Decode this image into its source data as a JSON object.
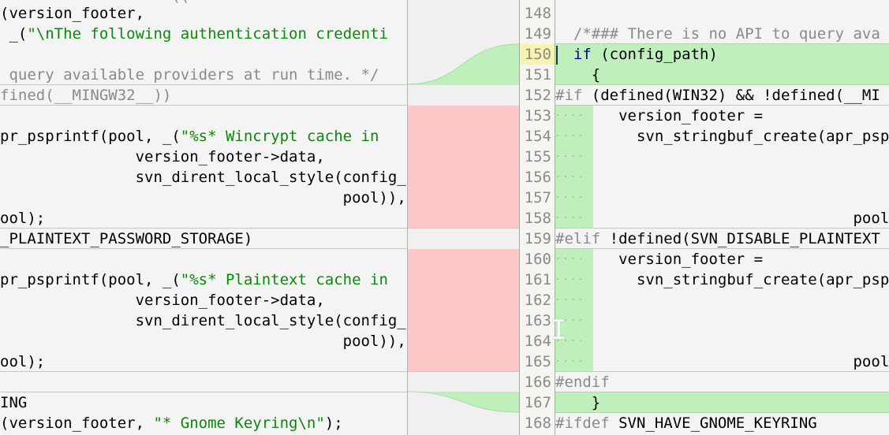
{
  "left_pane": {
    "lines": [
      {
        "text": "                   ((",
        "kind": "partial-top"
      },
      {
        "text": "(version_footer,",
        "kind": "code"
      },
      {
        "pre": " _(",
        "str": "\"\\nThe following authentication credenti",
        "kind": "code-string"
      },
      {
        "text": "",
        "kind": "blank"
      },
      {
        "text": " query available providers at run time. */",
        "kind": "comment"
      },
      {
        "text": "fined(__MINGW32__))",
        "kind": "preproc"
      },
      {
        "text": "",
        "kind": "blank"
      },
      {
        "pre": "pr_psprintf(pool, _(",
        "str": "\"%s* Wincrypt cache in ",
        "kind": "code-string"
      },
      {
        "text": "               version_footer->data,",
        "kind": "code"
      },
      {
        "text": "               svn_dirent_local_style(config_p",
        "kind": "code"
      },
      {
        "text": "                                      pool)),",
        "kind": "code"
      },
      {
        "text": "ool);",
        "kind": "code"
      },
      {
        "text": "_PLAINTEXT_PASSWORD_STORAGE)",
        "kind": "code"
      },
      {
        "text": "",
        "kind": "blank"
      },
      {
        "pre": "pr_psprintf(pool, _(",
        "str": "\"%s* Plaintext cache in",
        "kind": "code-string"
      },
      {
        "text": "               version_footer->data,",
        "kind": "code"
      },
      {
        "text": "               svn_dirent_local_style(config_p",
        "kind": "code"
      },
      {
        "text": "                                      pool)),",
        "kind": "code"
      },
      {
        "text": "ool);",
        "kind": "code"
      },
      {
        "text": "",
        "kind": "blank"
      },
      {
        "text": "ING",
        "kind": "code"
      },
      {
        "pre": "(version_footer, ",
        "str": "\"* Gnome Keyring\\n\"",
        "post": ");",
        "kind": "code-string"
      }
    ]
  },
  "right_pane": {
    "line_numbers": [
      "148",
      "149",
      "150",
      "151",
      "152",
      "153",
      "154",
      "155",
      "156",
      "157",
      "158",
      "159",
      "160",
      "161",
      "162",
      "163",
      "164",
      "165",
      "166",
      "167",
      "168"
    ],
    "current_line": "150",
    "lines": [
      {
        "text": ""
      },
      {
        "text": "  /*### There is no API to query ava",
        "kind": "comment"
      },
      {
        "kw": "if",
        "text": " (config_path)",
        "lead": "  ",
        "kind": "added"
      },
      {
        "text": "    {",
        "kind": "added"
      },
      {
        "pp": "#if",
        "text": " (defined(WIN32) && !defined(__MI",
        "kind": "preproc"
      },
      {
        "text": "   version_footer =",
        "kind": "indent-added"
      },
      {
        "text": "     svn_stringbuf_create(apr_psp",
        "kind": "indent-added"
      },
      {
        "text": "",
        "kind": "indent-added"
      },
      {
        "text": "",
        "kind": "indent-added"
      },
      {
        "text": "",
        "kind": "indent-added"
      },
      {
        "text": "                             pool);",
        "kind": "indent-added"
      },
      {
        "pp": "#elif",
        "text": " !defined(SVN_DISABLE_PLAINTEXT",
        "kind": "preproc"
      },
      {
        "text": "   version_footer =",
        "kind": "indent-added"
      },
      {
        "text": "     svn_stringbuf_create(apr_psp",
        "kind": "indent-added"
      },
      {
        "text": "",
        "kind": "indent-added"
      },
      {
        "text": "",
        "kind": "indent-added"
      },
      {
        "text": "",
        "kind": "indent-added"
      },
      {
        "text": "                             pool);",
        "kind": "indent-added"
      },
      {
        "pp": "#endif",
        "text": "",
        "kind": "preproc"
      },
      {
        "text": "    }",
        "kind": "added"
      },
      {
        "pp": "#ifdef",
        "text": " SVN_HAVE_GNOME_KEYRING",
        "kind": "preproc"
      }
    ],
    "whitespace_marker": "····"
  },
  "colors": {
    "added": "#bff0bb",
    "deleted": "#ffc8c8",
    "string": "#0a8a0a",
    "keyword": "#000080",
    "comment": "#8a8a8a",
    "current_line_number": "#f7f4b0"
  }
}
